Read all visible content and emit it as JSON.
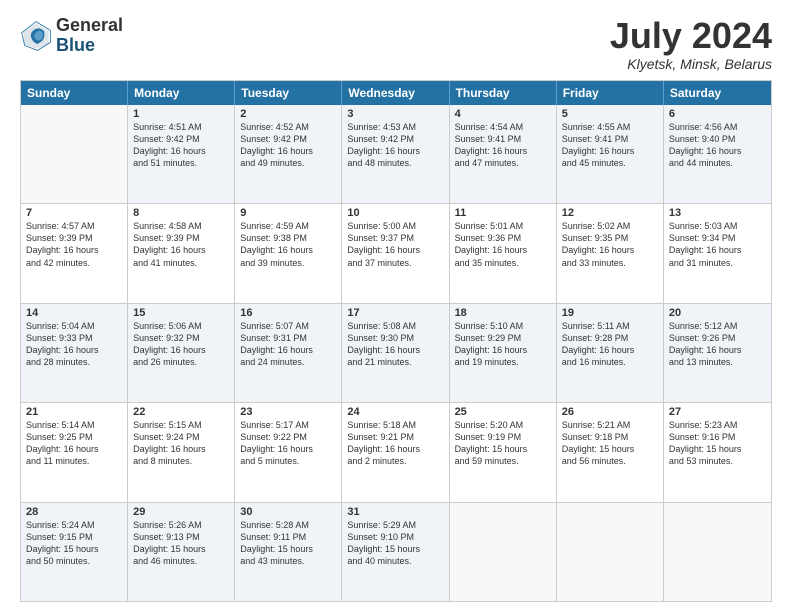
{
  "header": {
    "logo_general": "General",
    "logo_blue": "Blue",
    "month_title": "July 2024",
    "location": "Klyetsk, Minsk, Belarus"
  },
  "calendar": {
    "weekdays": [
      "Sunday",
      "Monday",
      "Tuesday",
      "Wednesday",
      "Thursday",
      "Friday",
      "Saturday"
    ],
    "rows": [
      [
        {
          "day": "",
          "lines": []
        },
        {
          "day": "1",
          "lines": [
            "Sunrise: 4:51 AM",
            "Sunset: 9:42 PM",
            "Daylight: 16 hours",
            "and 51 minutes."
          ]
        },
        {
          "day": "2",
          "lines": [
            "Sunrise: 4:52 AM",
            "Sunset: 9:42 PM",
            "Daylight: 16 hours",
            "and 49 minutes."
          ]
        },
        {
          "day": "3",
          "lines": [
            "Sunrise: 4:53 AM",
            "Sunset: 9:42 PM",
            "Daylight: 16 hours",
            "and 48 minutes."
          ]
        },
        {
          "day": "4",
          "lines": [
            "Sunrise: 4:54 AM",
            "Sunset: 9:41 PM",
            "Daylight: 16 hours",
            "and 47 minutes."
          ]
        },
        {
          "day": "5",
          "lines": [
            "Sunrise: 4:55 AM",
            "Sunset: 9:41 PM",
            "Daylight: 16 hours",
            "and 45 minutes."
          ]
        },
        {
          "day": "6",
          "lines": [
            "Sunrise: 4:56 AM",
            "Sunset: 9:40 PM",
            "Daylight: 16 hours",
            "and 44 minutes."
          ]
        }
      ],
      [
        {
          "day": "7",
          "lines": [
            "Sunrise: 4:57 AM",
            "Sunset: 9:39 PM",
            "Daylight: 16 hours",
            "and 42 minutes."
          ]
        },
        {
          "day": "8",
          "lines": [
            "Sunrise: 4:58 AM",
            "Sunset: 9:39 PM",
            "Daylight: 16 hours",
            "and 41 minutes."
          ]
        },
        {
          "day": "9",
          "lines": [
            "Sunrise: 4:59 AM",
            "Sunset: 9:38 PM",
            "Daylight: 16 hours",
            "and 39 minutes."
          ]
        },
        {
          "day": "10",
          "lines": [
            "Sunrise: 5:00 AM",
            "Sunset: 9:37 PM",
            "Daylight: 16 hours",
            "and 37 minutes."
          ]
        },
        {
          "day": "11",
          "lines": [
            "Sunrise: 5:01 AM",
            "Sunset: 9:36 PM",
            "Daylight: 16 hours",
            "and 35 minutes."
          ]
        },
        {
          "day": "12",
          "lines": [
            "Sunrise: 5:02 AM",
            "Sunset: 9:35 PM",
            "Daylight: 16 hours",
            "and 33 minutes."
          ]
        },
        {
          "day": "13",
          "lines": [
            "Sunrise: 5:03 AM",
            "Sunset: 9:34 PM",
            "Daylight: 16 hours",
            "and 31 minutes."
          ]
        }
      ],
      [
        {
          "day": "14",
          "lines": [
            "Sunrise: 5:04 AM",
            "Sunset: 9:33 PM",
            "Daylight: 16 hours",
            "and 28 minutes."
          ]
        },
        {
          "day": "15",
          "lines": [
            "Sunrise: 5:06 AM",
            "Sunset: 9:32 PM",
            "Daylight: 16 hours",
            "and 26 minutes."
          ]
        },
        {
          "day": "16",
          "lines": [
            "Sunrise: 5:07 AM",
            "Sunset: 9:31 PM",
            "Daylight: 16 hours",
            "and 24 minutes."
          ]
        },
        {
          "day": "17",
          "lines": [
            "Sunrise: 5:08 AM",
            "Sunset: 9:30 PM",
            "Daylight: 16 hours",
            "and 21 minutes."
          ]
        },
        {
          "day": "18",
          "lines": [
            "Sunrise: 5:10 AM",
            "Sunset: 9:29 PM",
            "Daylight: 16 hours",
            "and 19 minutes."
          ]
        },
        {
          "day": "19",
          "lines": [
            "Sunrise: 5:11 AM",
            "Sunset: 9:28 PM",
            "Daylight: 16 hours",
            "and 16 minutes."
          ]
        },
        {
          "day": "20",
          "lines": [
            "Sunrise: 5:12 AM",
            "Sunset: 9:26 PM",
            "Daylight: 16 hours",
            "and 13 minutes."
          ]
        }
      ],
      [
        {
          "day": "21",
          "lines": [
            "Sunrise: 5:14 AM",
            "Sunset: 9:25 PM",
            "Daylight: 16 hours",
            "and 11 minutes."
          ]
        },
        {
          "day": "22",
          "lines": [
            "Sunrise: 5:15 AM",
            "Sunset: 9:24 PM",
            "Daylight: 16 hours",
            "and 8 minutes."
          ]
        },
        {
          "day": "23",
          "lines": [
            "Sunrise: 5:17 AM",
            "Sunset: 9:22 PM",
            "Daylight: 16 hours",
            "and 5 minutes."
          ]
        },
        {
          "day": "24",
          "lines": [
            "Sunrise: 5:18 AM",
            "Sunset: 9:21 PM",
            "Daylight: 16 hours",
            "and 2 minutes."
          ]
        },
        {
          "day": "25",
          "lines": [
            "Sunrise: 5:20 AM",
            "Sunset: 9:19 PM",
            "Daylight: 15 hours",
            "and 59 minutes."
          ]
        },
        {
          "day": "26",
          "lines": [
            "Sunrise: 5:21 AM",
            "Sunset: 9:18 PM",
            "Daylight: 15 hours",
            "and 56 minutes."
          ]
        },
        {
          "day": "27",
          "lines": [
            "Sunrise: 5:23 AM",
            "Sunset: 9:16 PM",
            "Daylight: 15 hours",
            "and 53 minutes."
          ]
        }
      ],
      [
        {
          "day": "28",
          "lines": [
            "Sunrise: 5:24 AM",
            "Sunset: 9:15 PM",
            "Daylight: 15 hours",
            "and 50 minutes."
          ]
        },
        {
          "day": "29",
          "lines": [
            "Sunrise: 5:26 AM",
            "Sunset: 9:13 PM",
            "Daylight: 15 hours",
            "and 46 minutes."
          ]
        },
        {
          "day": "30",
          "lines": [
            "Sunrise: 5:28 AM",
            "Sunset: 9:11 PM",
            "Daylight: 15 hours",
            "and 43 minutes."
          ]
        },
        {
          "day": "31",
          "lines": [
            "Sunrise: 5:29 AM",
            "Sunset: 9:10 PM",
            "Daylight: 15 hours",
            "and 40 minutes."
          ]
        },
        {
          "day": "",
          "lines": []
        },
        {
          "day": "",
          "lines": []
        },
        {
          "day": "",
          "lines": []
        }
      ]
    ]
  }
}
